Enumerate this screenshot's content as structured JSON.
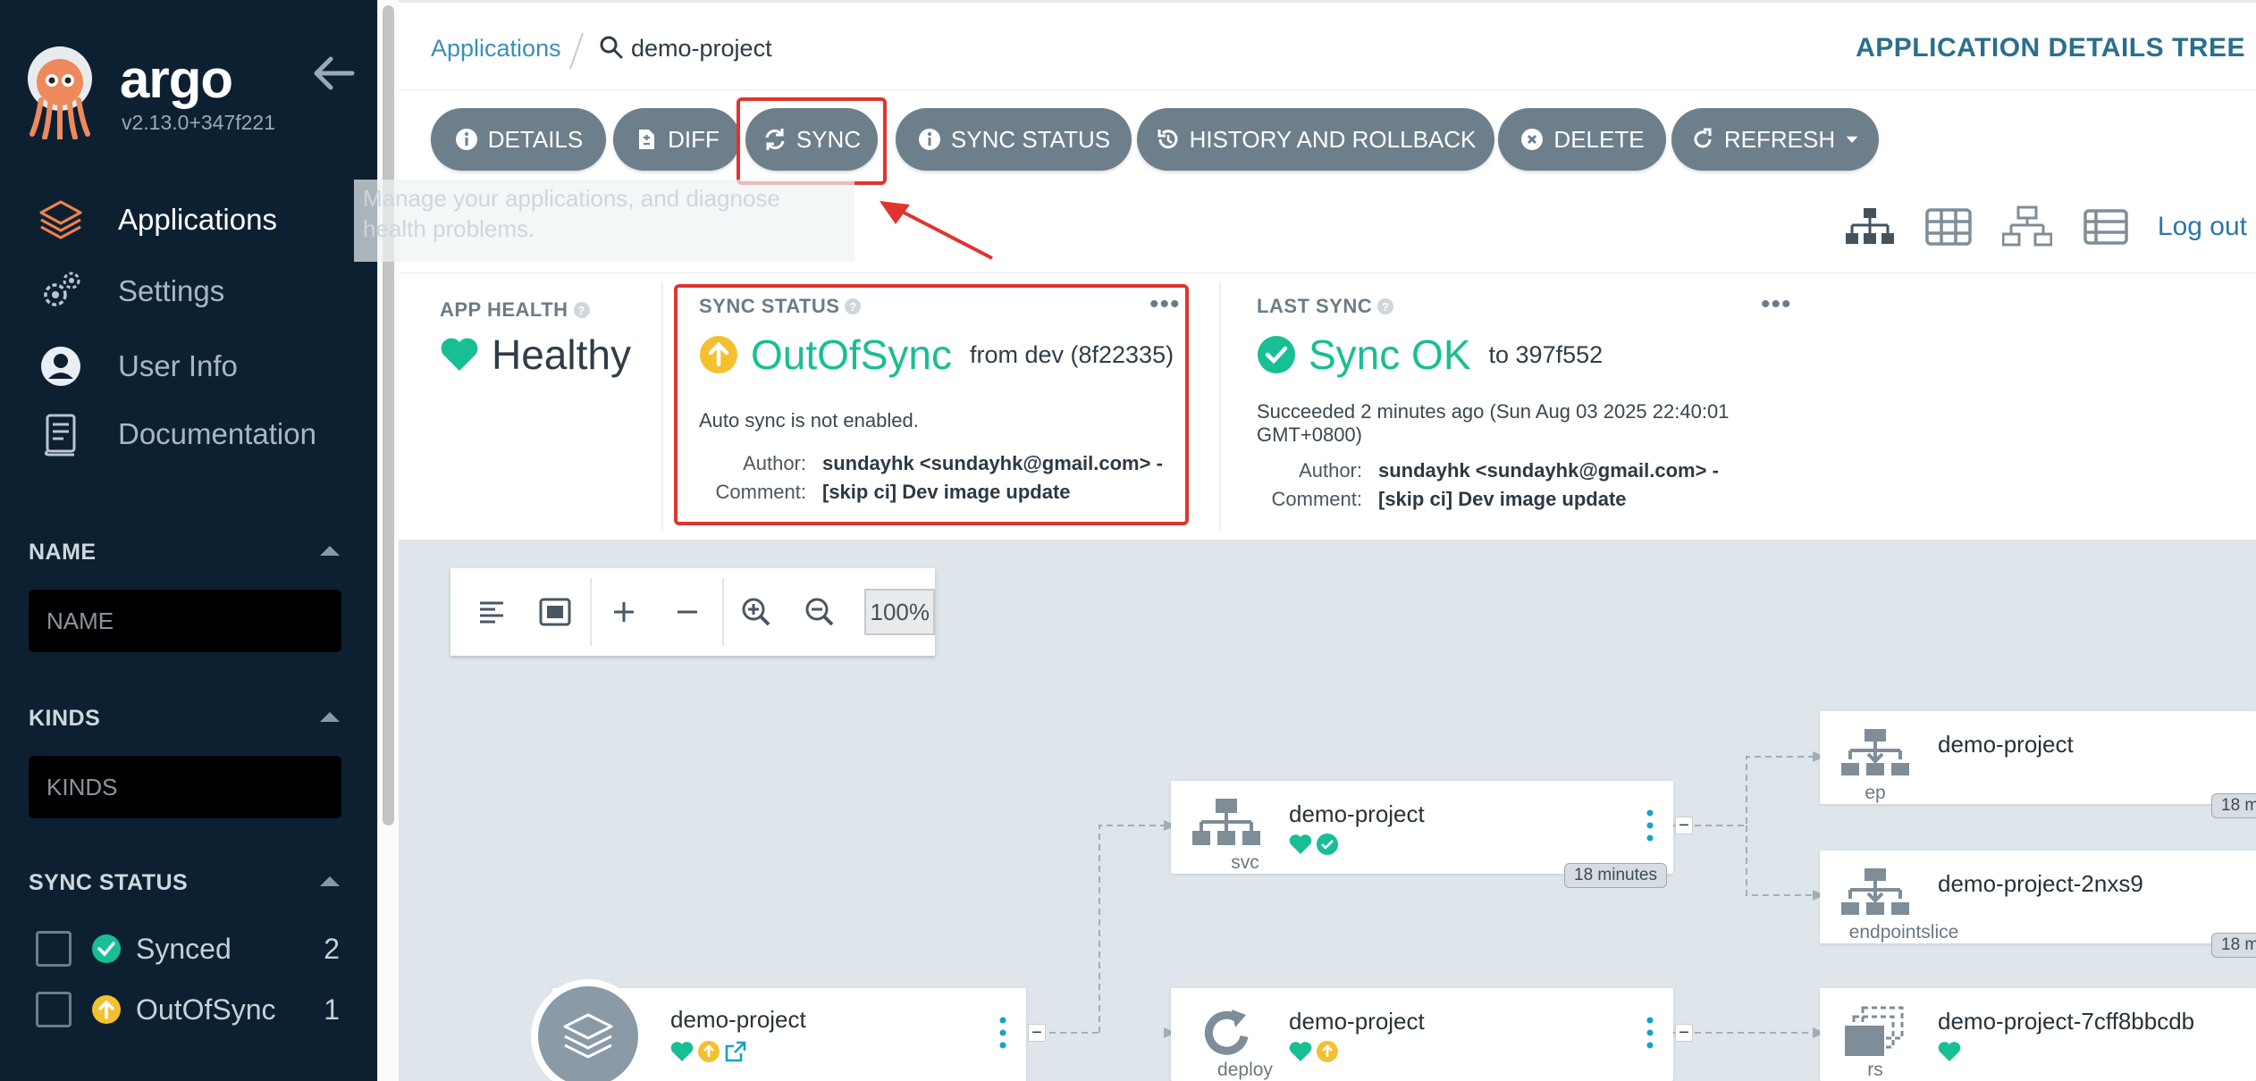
{
  "app": {
    "name": "argo",
    "version": "v2.13.0+347f221"
  },
  "sidebar": {
    "nav": [
      {
        "label": "Applications",
        "icon": "layers-icon",
        "active": true
      },
      {
        "label": "Settings",
        "icon": "gears-icon",
        "active": false
      },
      {
        "label": "User Info",
        "icon": "user-circle-icon",
        "active": false
      },
      {
        "label": "Documentation",
        "icon": "book-icon",
        "active": false
      }
    ],
    "filters": {
      "name_title": "NAME",
      "name_placeholder": "NAME",
      "kinds_title": "KINDS",
      "kinds_placeholder": "KINDS",
      "sync_title": "SYNC STATUS",
      "sync_options": [
        {
          "label": "Synced",
          "count": "2"
        },
        {
          "label": "OutOfSync",
          "count": "1"
        }
      ]
    }
  },
  "breadcrumb": {
    "parent": "Applications",
    "current": "demo-project"
  },
  "page_title": "APPLICATION DETAILS TREE",
  "actions": {
    "details": "DETAILS",
    "diff": "DIFF",
    "sync": "SYNC",
    "sync_status": "SYNC STATUS",
    "history": "HISTORY AND ROLLBACK",
    "delete": "DELETE",
    "refresh": "REFRESH"
  },
  "ghost_text": "Manage your applications, and diagnose health problems.",
  "logout": "Log out",
  "status": {
    "health": {
      "title": "APP HEALTH",
      "value": "Healthy"
    },
    "sync": {
      "title": "SYNC STATUS",
      "value": "OutOfSync",
      "from": "from dev (8f22335)",
      "note": "Auto sync is not enabled.",
      "author_label": "Author:",
      "author": "sundayhk <sundayhk@gmail.com> -",
      "comment_label": "Comment:",
      "comment": "[skip ci] Dev image update"
    },
    "last_sync": {
      "title": "LAST SYNC",
      "value": "Sync OK",
      "to": "to 397f552",
      "when": "Succeeded 2 minutes ago (Sun Aug 03 2025 22:40:01 GMT+0800)",
      "author_label": "Author:",
      "author": "sundayhk <sundayhk@gmail.com> -",
      "comment_label": "Comment:",
      "comment": "[skip ci] Dev image update"
    }
  },
  "zoom": {
    "level": "100%"
  },
  "tree": {
    "app_node": {
      "name": "demo-project"
    },
    "svc": {
      "name": "demo-project",
      "kind": "svc",
      "age": "18 minutes"
    },
    "deploy": {
      "name": "demo-project",
      "kind": "deploy"
    },
    "ep": {
      "name": "demo-project",
      "kind": "ep",
      "age": "18 m"
    },
    "endpointslice": {
      "name": "demo-project-2nxs9",
      "kind": "endpointslice",
      "age": "18 m"
    },
    "rs": {
      "name": "demo-project-7cff8bbcdb",
      "kind": "rs"
    }
  },
  "colors": {
    "sidebar_bg": "#0d2031",
    "button_bg": "#6d7f8b",
    "healthy": "#18be94",
    "out_of_sync": "#f4c030",
    "highlight": "#e0342f",
    "canvas_bg": "#dee6eb"
  }
}
